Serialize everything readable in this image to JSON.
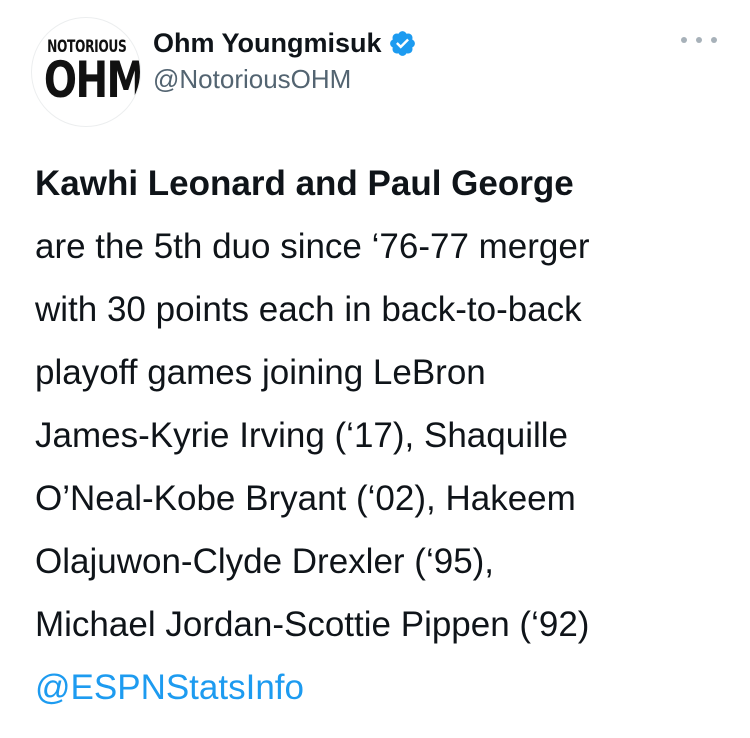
{
  "tweet": {
    "author": {
      "display_name": "Ohm Youngmisuk",
      "handle": "@NotoriousOHM",
      "verified": true,
      "avatar": {
        "top_text": "NOTORIOUS",
        "bottom_text": "OHM"
      }
    },
    "more_icon": "more-horizontal-icon",
    "body": {
      "lines": [
        "Kawhi Leonard and Paul George",
        "are the 5th duo since ‘76-77 merger",
        "with 30 points each in back-to-back",
        "playoff games joining LeBron",
        "James-Kyrie Irving (‘17), Shaquille",
        "O’Neal-Kobe Bryant (‘02), Hakeem",
        "Olajuwon-Clyde Drexler (‘95),",
        "Michael Jordan-Scottie Pippen (‘92)"
      ],
      "mention": "@ESPNStatsInfo"
    }
  },
  "colors": {
    "text": "#0f1419",
    "secondary": "#536471",
    "link": "#1d9bf0",
    "verified_badge": "#1d9bf0"
  }
}
